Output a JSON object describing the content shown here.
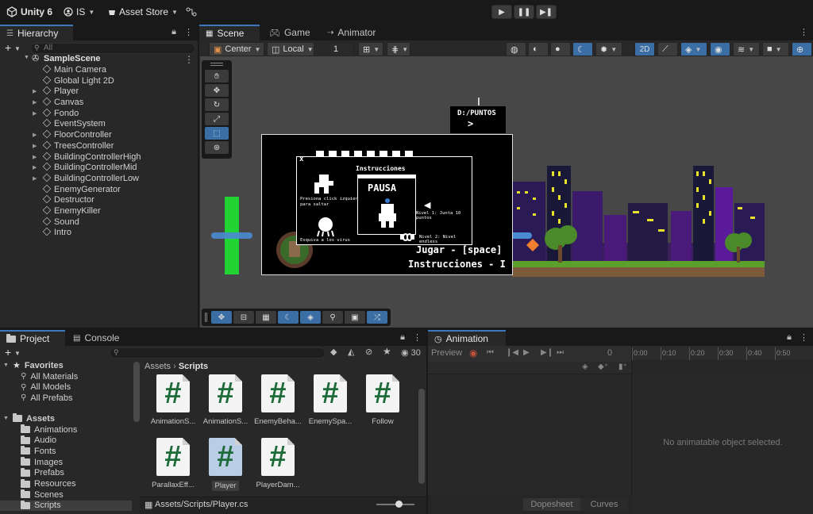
{
  "toolbar": {
    "app_name": "Unity 6",
    "account": "IS",
    "asset_store": "Asset Store"
  },
  "hierarchy": {
    "tab": "Hierarchy",
    "search_placeholder": "All",
    "scene_name": "SampleScene",
    "items": [
      {
        "label": "Main Camera",
        "expandable": false
      },
      {
        "label": "Global Light 2D",
        "expandable": false
      },
      {
        "label": "Player",
        "expandable": true
      },
      {
        "label": "Canvas",
        "expandable": true
      },
      {
        "label": "Fondo",
        "expandable": true
      },
      {
        "label": "EventSystem",
        "expandable": false
      },
      {
        "label": "FloorController",
        "expandable": true
      },
      {
        "label": "TreesController",
        "expandable": true
      },
      {
        "label": "BuildingControllerHigh",
        "expandable": true
      },
      {
        "label": "BuildingControllerMid",
        "expandable": true
      },
      {
        "label": "BuildingControllerLow",
        "expandable": true
      },
      {
        "label": "EnemyGenerator",
        "expandable": false
      },
      {
        "label": "Destructor",
        "expandable": false
      },
      {
        "label": "EnemyKiller",
        "expandable": false
      },
      {
        "label": "Sound",
        "expandable": false
      },
      {
        "label": "Intro",
        "expandable": false
      }
    ]
  },
  "scene": {
    "tabs": [
      "Scene",
      "Game",
      "Animator"
    ],
    "pivot": "Center",
    "space": "Local",
    "grid_snap": "1",
    "mode_2d": "2D"
  },
  "game": {
    "score_label": "D:/PUNTOS",
    "score_arrow": ">",
    "instructions_title": "Instrucciones",
    "pause": "PAUSA",
    "close": "x",
    "hint_jump": "Presiona click izquierdo para saltar",
    "hint_dodge": "Esquiva a los virus",
    "hint_points": "Nivel 1: Junta 10 puntos",
    "hint_level": "Nivel 2: Nivel endless",
    "menu_play": "Jugar - [space]",
    "menu_instructions": "Instrucciones - I"
  },
  "project": {
    "tabs": [
      "Project",
      "Console"
    ],
    "hidden_count": "30",
    "favorites_label": "Favorites",
    "favorites": [
      "All Materials",
      "All Models",
      "All Prefabs"
    ],
    "assets_label": "Assets",
    "folders": [
      "Animations",
      "Audio",
      "Fonts",
      "Images",
      "Prefabs",
      "Resources",
      "Scenes",
      "Scripts"
    ],
    "breadcrumb_root": "Assets",
    "breadcrumb_current": "Scripts",
    "files": [
      "AnimationS...",
      "AnimationS...",
      "EnemyBeha...",
      "EnemySpa...",
      "Follow",
      "ParallaxEff...",
      "Player",
      "PlayerDam..."
    ],
    "file_glyph": "#",
    "selected_path": "Assets/Scripts/Player.cs"
  },
  "animation": {
    "tab": "Animation",
    "preview": "Preview",
    "frame": "0",
    "ruler": [
      "0:00",
      "0:10",
      "0:20",
      "0:30",
      "0:40",
      "0:50"
    ],
    "empty_message": "No animatable object selected.",
    "bottom_tabs": [
      "Dopesheet",
      "Curves"
    ]
  },
  "colors": {
    "accent_blue": "#3a79bb",
    "panel": "#282828",
    "scene_bg": "#474747"
  }
}
